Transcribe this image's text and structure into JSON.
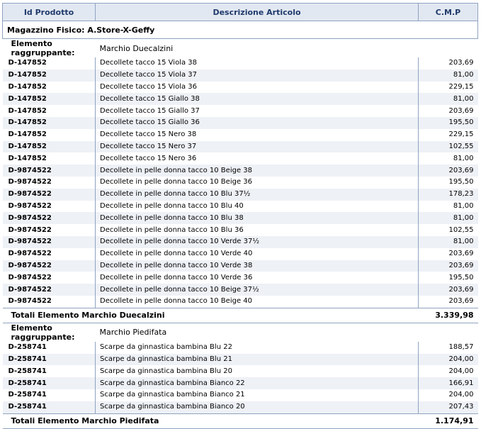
{
  "headers": {
    "id": "Id Prodotto",
    "desc": "Descrizione Articolo",
    "cmp": "C.M.P"
  },
  "magazzino": "Magazzino Fisico: A.Store-X-Geffy",
  "groups": [
    {
      "label": "Elemento raggruppante:",
      "name": "Marchio Duecalzini",
      "rows": [
        [
          "D-147852",
          "Decollete tacco 15 Viola 38",
          "203,69"
        ],
        [
          "D-147852",
          "Decollete tacco 15 Viola 37",
          "81,00"
        ],
        [
          "D-147852",
          "Decollete tacco 15 Viola 36",
          "229,15"
        ],
        [
          "D-147852",
          "Decollete tacco 15 Giallo 38",
          "81,00"
        ],
        [
          "D-147852",
          "Decollete tacco 15 Giallo 37",
          "203,69"
        ],
        [
          "D-147852",
          "Decollete tacco 15 Giallo 36",
          "195,50"
        ],
        [
          "D-147852",
          "Decollete tacco 15 Nero 38",
          "229,15"
        ],
        [
          "D-147852",
          "Decollete tacco 15 Nero 37",
          "102,55"
        ],
        [
          "D-147852",
          "Decollete tacco 15 Nero 36",
          "81,00"
        ],
        [
          "D-9874522",
          "Decollete in pelle donna tacco 10 Beige 38",
          "203,69"
        ],
        [
          "D-9874522",
          "Decollete in pelle donna tacco 10 Beige 36",
          "195,50"
        ],
        [
          "D-9874522",
          "Decollete in pelle donna tacco 10 Blu 37½",
          "178,23"
        ],
        [
          "D-9874522",
          "Decollete in pelle donna tacco 10 Blu 40",
          "81,00"
        ],
        [
          "D-9874522",
          "Decollete in pelle donna tacco 10 Blu 38",
          "81,00"
        ],
        [
          "D-9874522",
          "Decollete in pelle donna tacco 10 Blu 36",
          "102,55"
        ],
        [
          "D-9874522",
          "Decollete in pelle donna tacco 10 Verde 37½",
          "81,00"
        ],
        [
          "D-9874522",
          "Decollete in pelle donna tacco 10 Verde 40",
          "203,69"
        ],
        [
          "D-9874522",
          "Decollete in pelle donna tacco 10 Verde 38",
          "203,69"
        ],
        [
          "D-9874522",
          "Decollete in pelle donna tacco 10 Verde 36",
          "195,50"
        ],
        [
          "D-9874522",
          "Decollete in pelle donna tacco 10 Beige 37½",
          "203,69"
        ],
        [
          "D-9874522",
          "Decollete in pelle donna tacco 10 Beige 40",
          "203,69"
        ]
      ],
      "total_label": "Totali Elemento Marchio Duecalzini",
      "total_value": "3.339,98"
    },
    {
      "label": "Elemento raggruppante:",
      "name": "Marchio Piedifata",
      "rows": [
        [
          "D-258741",
          "Scarpe da ginnastica bambina Blu 22",
          "188,57"
        ],
        [
          "D-258741",
          "Scarpe da ginnastica bambina Blu 21",
          "204,00"
        ],
        [
          "D-258741",
          "Scarpe da ginnastica bambina Blu 20",
          "204,00"
        ],
        [
          "D-258741",
          "Scarpe da ginnastica bambina Bianco 22",
          "166,91"
        ],
        [
          "D-258741",
          "Scarpe da ginnastica bambina Bianco 21",
          "204,00"
        ],
        [
          "D-258741",
          "Scarpe da ginnastica bambina Bianco 20",
          "207,43"
        ]
      ],
      "total_label": "Totali Elemento Marchio Piedifata",
      "total_value": "1.174,91"
    }
  ]
}
